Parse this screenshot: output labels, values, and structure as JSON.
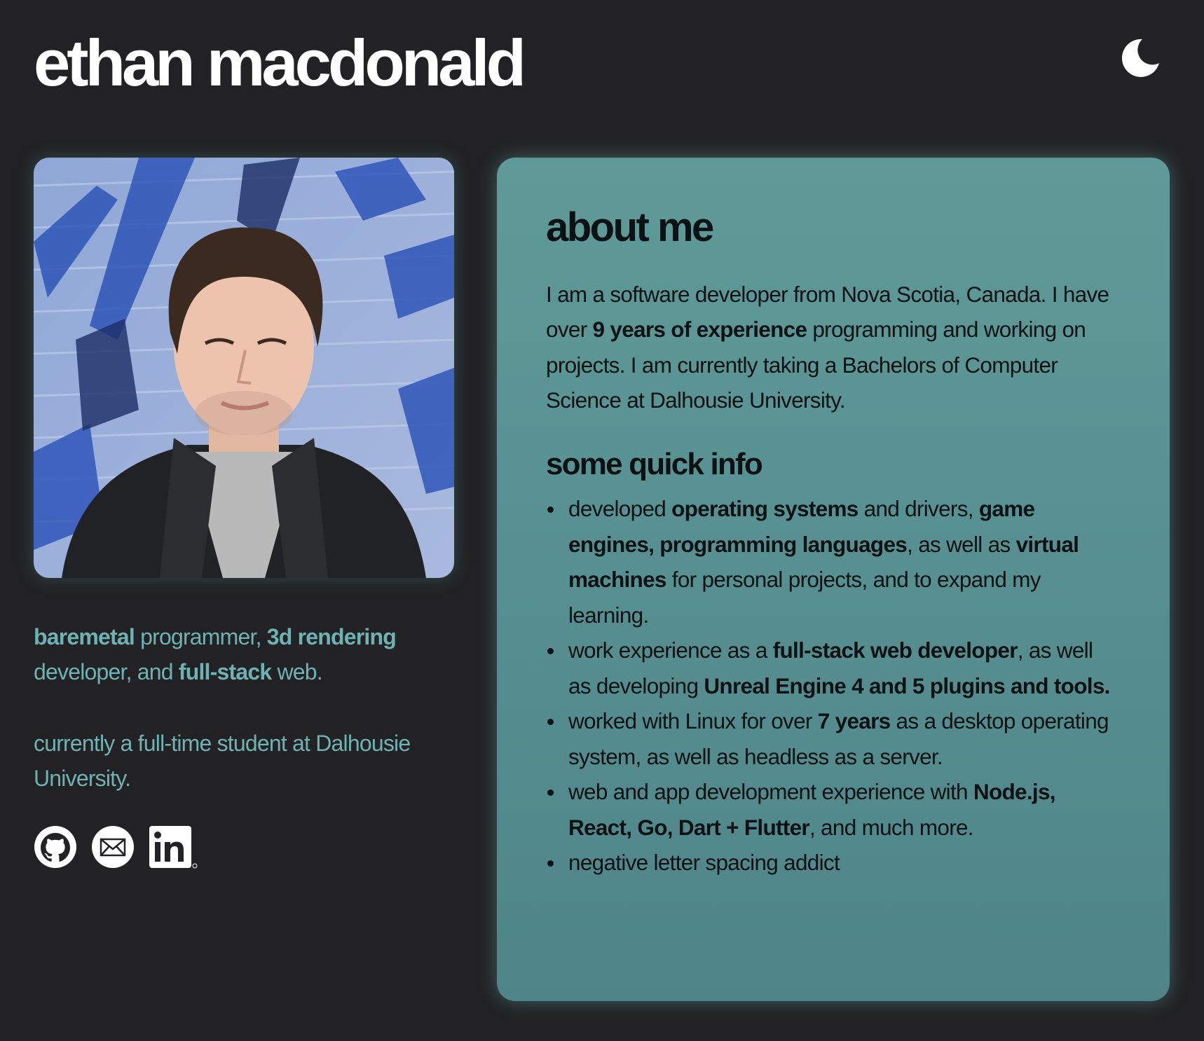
{
  "header": {
    "title": "ethan macdonald",
    "theme_toggle_icon": "moon-icon"
  },
  "profile": {
    "photo_alt": "portrait photo",
    "tagline": {
      "part1_bold": "baremetal",
      "part2": " programmer, ",
      "part3_bold": "3d rendering",
      "part4": " developer, and ",
      "part5_bold": "full-stack",
      "part6": " web."
    },
    "status": "currently a full-time student at Dalhousie University."
  },
  "socials": [
    {
      "icon": "github-icon",
      "label": "GitHub"
    },
    {
      "icon": "mail-icon",
      "label": "Email"
    },
    {
      "icon": "linkedin-icon",
      "label": "LinkedIn"
    }
  ],
  "about": {
    "heading": "about me",
    "bio": {
      "a": "I am a software developer from Nova Scotia, Canada. I have over ",
      "b_bold": "9 years of experience",
      "c": " programming and working on projects. I am currently taking a Bachelors of Computer Science at Dalhousie University."
    },
    "quick_info_heading": "some quick info",
    "items": [
      {
        "t1": "developed ",
        "b1": "operating systems",
        "t2": " and drivers, ",
        "b2": "game engines, programming languages",
        "t3": ", as well as ",
        "b3": "virtual machines",
        "t4": " for personal projects, and to expand my learning."
      },
      {
        "t1": "work experience as a ",
        "b1": "full-stack web developer",
        "t2": ", as well as developing ",
        "b2": "Unreal Engine 4 and 5 plugins and tools."
      },
      {
        "t1": "worked with Linux for over ",
        "b1": "7 years",
        "t2": " as a desktop operating system, as well as headless as a server."
      },
      {
        "t1": "web and app development experience with ",
        "b1": "Node.js, React, Go, Dart + Flutter",
        "t2": ", and much more."
      },
      {
        "t1": "negative letter spacing addict"
      }
    ]
  },
  "colors": {
    "background": "#222224",
    "accent_text": "#6fb2b4",
    "card": "#5a9494"
  }
}
